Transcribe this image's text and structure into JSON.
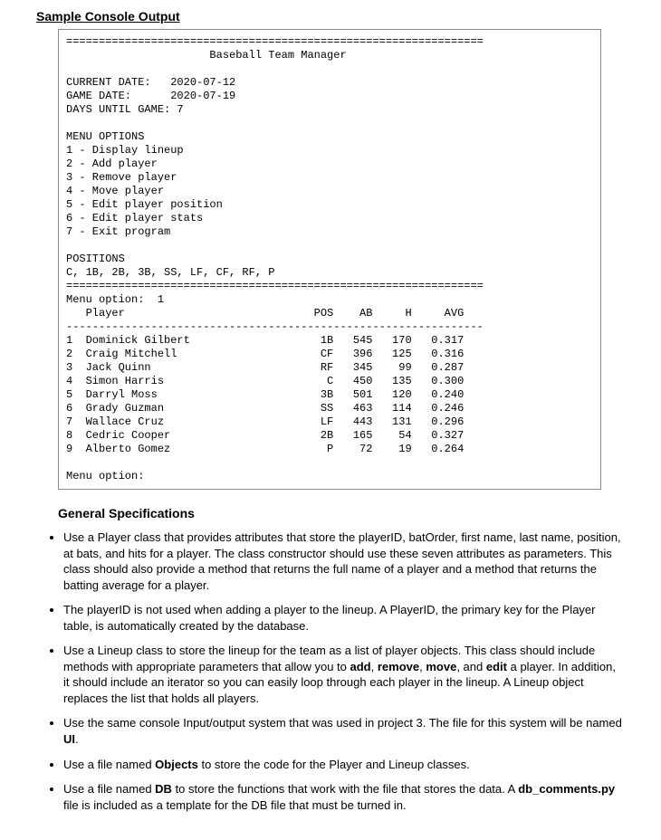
{
  "heading": "Sample Console Output",
  "console": {
    "divider": "================================================================",
    "dashline": "----------------------------------------------------------------",
    "title": "Baseball Team Manager",
    "current_date_label": "CURRENT DATE:",
    "current_date": "2020-07-12",
    "game_date_label": "GAME DATE:",
    "game_date": "2020-07-19",
    "days_until_label": "DAYS UNTIL GAME:",
    "days_until": "7",
    "menu_options_label": "MENU OPTIONS",
    "menu_options": [
      "1 - Display lineup",
      "2 - Add player",
      "3 - Remove player",
      "4 - Move player",
      "5 - Edit player position",
      "6 - Edit player stats",
      "7 - Exit program"
    ],
    "positions_label": "POSITIONS",
    "positions": "C, 1B, 2B, 3B, SS, LF, CF, RF, P",
    "menu_option_label": "Menu option:",
    "menu_option_input": "1",
    "header": {
      "player": "Player",
      "pos": "POS",
      "ab": "AB",
      "h": "H",
      "avg": "AVG"
    },
    "lineup": [
      {
        "n": "1",
        "name": "Dominick Gilbert",
        "pos": "1B",
        "ab": "545",
        "h": "170",
        "avg": "0.317"
      },
      {
        "n": "2",
        "name": "Craig Mitchell",
        "pos": "CF",
        "ab": "396",
        "h": "125",
        "avg": "0.316"
      },
      {
        "n": "3",
        "name": "Jack Quinn",
        "pos": "RF",
        "ab": "345",
        "h": "99",
        "avg": "0.287"
      },
      {
        "n": "4",
        "name": "Simon Harris",
        "pos": "C",
        "ab": "450",
        "h": "135",
        "avg": "0.300"
      },
      {
        "n": "5",
        "name": "Darryl Moss",
        "pos": "3B",
        "ab": "501",
        "h": "120",
        "avg": "0.240"
      },
      {
        "n": "6",
        "name": "Grady Guzman",
        "pos": "SS",
        "ab": "463",
        "h": "114",
        "avg": "0.246"
      },
      {
        "n": "7",
        "name": "Wallace Cruz",
        "pos": "LF",
        "ab": "443",
        "h": "131",
        "avg": "0.296"
      },
      {
        "n": "8",
        "name": "Cedric Cooper",
        "pos": "2B",
        "ab": "165",
        "h": "54",
        "avg": "0.327"
      },
      {
        "n": "9",
        "name": "Alberto Gomez",
        "pos": "P",
        "ab": "72",
        "h": "19",
        "avg": "0.264"
      }
    ],
    "menu_option_label2": "Menu option:"
  },
  "spec_heading": "General Specifications",
  "specs": [
    {
      "pre": "Use a Player class that provides attributes that store the playerID, batOrder, first name, last name, position, at bats, and hits for a player. The class constructor should use these seven attributes as parameters. This class should also provide a method that returns the full name of a player and a method that returns the batting average for a player.",
      "bold": []
    },
    {
      "pre": "The playerID is not used when adding a player to the lineup. A PlayerID, the primary key for the Player table, is automatically created by the database.",
      "bold": []
    },
    {
      "pre": "Use a Lineup class to store the lineup for the team as a list of player objects. This class should include methods with appropriate parameters that allow you to ",
      "bold": [
        "add"
      ],
      "mid1": ", ",
      "bold2": [
        "remove"
      ],
      "mid2": ", ",
      "bold3": [
        "move"
      ],
      "mid3": ", and ",
      "bold4": [
        "edit"
      ],
      "post": " a player. In addition, it should include an iterator so you can easily loop through each player in the lineup. A Lineup object replaces the list that holds all players."
    },
    {
      "pre": "Use the same console Input/output system that was used in project 3. The file for this system will be named ",
      "bold": [
        "UI"
      ],
      "post": "."
    },
    {
      "pre": "Use a file named ",
      "bold": [
        "Objects"
      ],
      "post": " to store the code for the Player and Lineup classes."
    },
    {
      "pre": "Use a file named ",
      "bold": [
        "DB"
      ],
      "mid1": " to store the functions that work with the file that stores the data. A ",
      "bold2": [
        "db_comments.py"
      ],
      "post": " file is included as a template for the DB file that must be turned in."
    }
  ]
}
